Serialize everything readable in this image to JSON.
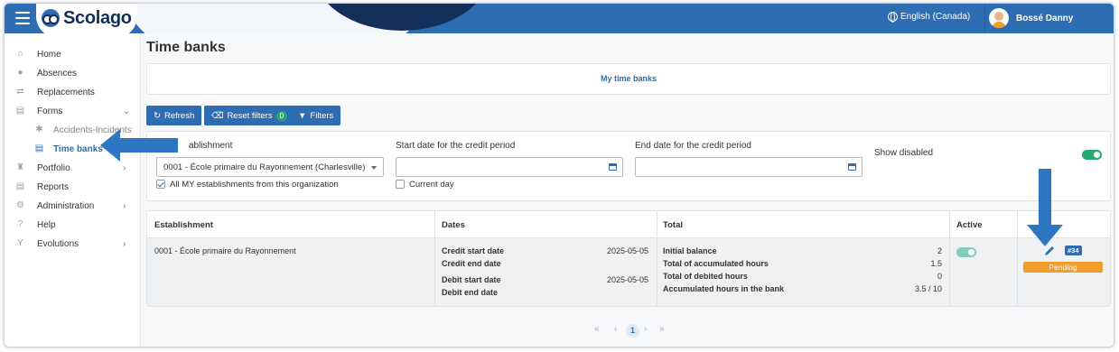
{
  "header": {
    "app_name": "Scolago",
    "language": "English (Canada)",
    "user_name": "Bossé Danny"
  },
  "sidebar": {
    "items": [
      {
        "label": "Home",
        "icon": "home-icon"
      },
      {
        "label": "Absences",
        "icon": "users-icon"
      },
      {
        "label": "Replacements",
        "icon": "replace-icon"
      },
      {
        "label": "Forms",
        "icon": "document-icon"
      },
      {
        "label": "Accidents-Incidents",
        "icon": "accident-icon"
      },
      {
        "label": "Time banks",
        "icon": "document-icon"
      },
      {
        "label": "Portfolio",
        "icon": "trophy-icon"
      },
      {
        "label": "Reports",
        "icon": "report-icon"
      },
      {
        "label": "Administration",
        "icon": "gear-icon"
      },
      {
        "label": "Help",
        "icon": "question-icon"
      },
      {
        "label": "Evolutions",
        "icon": "sprout-icon"
      }
    ]
  },
  "page": {
    "title": "Time banks",
    "tab_label": "My time banks"
  },
  "toolbar": {
    "refresh_label": "Refresh",
    "reset_label": "Reset filters",
    "reset_count": "0",
    "filters_label": "Filters"
  },
  "filters": {
    "establishment_label": "ablishment",
    "establishment_value": "0001 - École primaire du Rayonnement (Charlesville)",
    "all_establishments_label": "All MY establishments from this organization",
    "start_label": "Start date for the credit period",
    "start_value": "",
    "current_day_label": "Current day",
    "end_label": "End date for the credit period",
    "end_value": "",
    "show_disabled_label": "Show disabled",
    "show_disabled": true
  },
  "table": {
    "headers": [
      "Establishment",
      "Dates",
      "Total",
      "Active"
    ],
    "row": {
      "establishment": "0001 - École primaire du Rayonnement",
      "dates": [
        {
          "label": "Credit start date",
          "value": "2025-05-05"
        },
        {
          "label": "Credit end date",
          "value": ""
        },
        {
          "label": "Debit start date",
          "value": "2025-05-05"
        },
        {
          "label": "Debit end date",
          "value": ""
        }
      ],
      "totals": [
        {
          "label": "Initial balance",
          "value": "2"
        },
        {
          "label": "Total of accumulated hours",
          "value": "1.5"
        },
        {
          "label": "Total of debited hours",
          "value": "0"
        },
        {
          "label": "Accumulated hours in the bank",
          "value": "3.5 / 10"
        }
      ],
      "active": true,
      "id_tag": "#34",
      "status": "Pending"
    }
  },
  "pagination": {
    "first": "«",
    "prev": "‹",
    "current": "1",
    "next": "›",
    "last": "»"
  },
  "colors": {
    "brand": "#2e6db2",
    "navy": "#12305a",
    "toggle_on": "#27a96f",
    "pending": "#f29c2b",
    "annotation_arrow": "#2e76c2"
  }
}
